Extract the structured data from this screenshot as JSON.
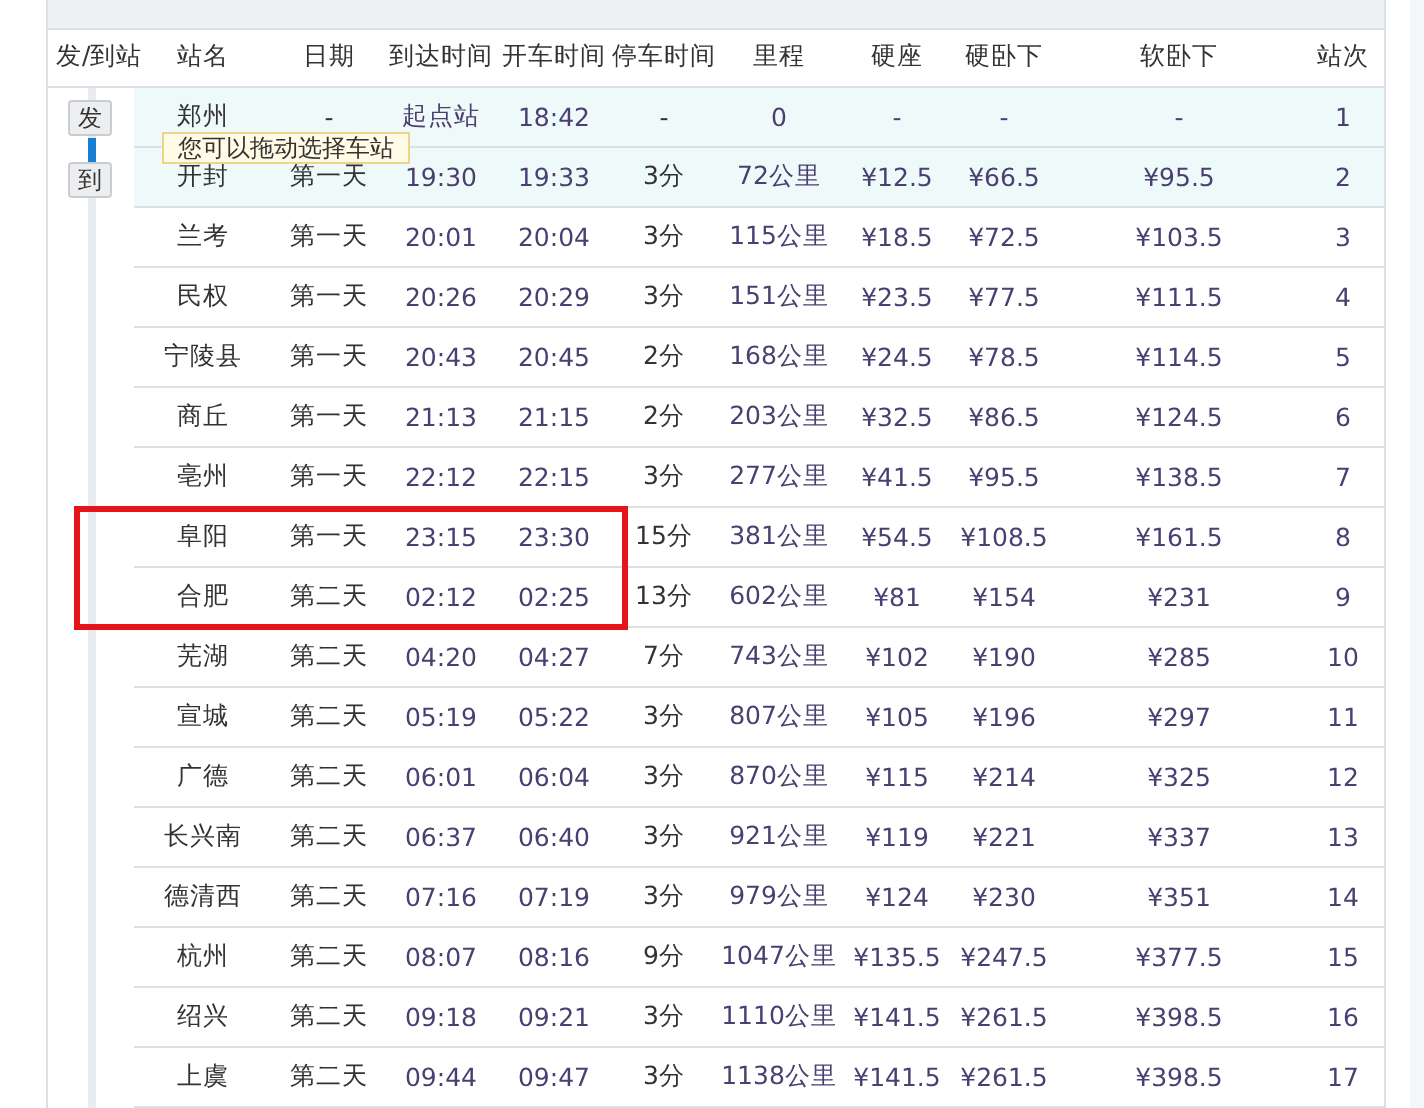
{
  "columns": [
    "发/到站",
    "站名",
    "日期",
    "到达时间",
    "开车时间",
    "停车时间",
    "里程",
    "硬座",
    "硬卧下",
    "软卧下",
    "站次"
  ],
  "slider": {
    "from_label": "发",
    "to_label": "到",
    "tooltip": "您可以拖动选择车站"
  },
  "rows": [
    {
      "cells": [
        "郑州",
        "-",
        "起点站",
        "18:42",
        "-",
        "0",
        "-",
        "-",
        "-",
        "1"
      ],
      "selected": true,
      "outlined": false
    },
    {
      "cells": [
        "开封",
        "第一天",
        "19:30",
        "19:33",
        "3分",
        "72公里",
        "¥12.5",
        "¥66.5",
        "¥95.5",
        "2"
      ],
      "selected": true,
      "outlined": false
    },
    {
      "cells": [
        "兰考",
        "第一天",
        "20:01",
        "20:04",
        "3分",
        "115公里",
        "¥18.5",
        "¥72.5",
        "¥103.5",
        "3"
      ],
      "selected": false,
      "outlined": false
    },
    {
      "cells": [
        "民权",
        "第一天",
        "20:26",
        "20:29",
        "3分",
        "151公里",
        "¥23.5",
        "¥77.5",
        "¥111.5",
        "4"
      ],
      "selected": false,
      "outlined": false
    },
    {
      "cells": [
        "宁陵县",
        "第一天",
        "20:43",
        "20:45",
        "2分",
        "168公里",
        "¥24.5",
        "¥78.5",
        "¥114.5",
        "5"
      ],
      "selected": false,
      "outlined": false
    },
    {
      "cells": [
        "商丘",
        "第一天",
        "21:13",
        "21:15",
        "2分",
        "203公里",
        "¥32.5",
        "¥86.5",
        "¥124.5",
        "6"
      ],
      "selected": false,
      "outlined": false
    },
    {
      "cells": [
        "亳州",
        "第一天",
        "22:12",
        "22:15",
        "3分",
        "277公里",
        "¥41.5",
        "¥95.5",
        "¥138.5",
        "7"
      ],
      "selected": false,
      "outlined": false
    },
    {
      "cells": [
        "阜阳",
        "第一天",
        "23:15",
        "23:30",
        "15分",
        "381公里",
        "¥54.5",
        "¥108.5",
        "¥161.5",
        "8"
      ],
      "selected": false,
      "outlined": true
    },
    {
      "cells": [
        "合肥",
        "第二天",
        "02:12",
        "02:25",
        "13分",
        "602公里",
        "¥81",
        "¥154",
        "¥231",
        "9"
      ],
      "selected": false,
      "outlined": true
    },
    {
      "cells": [
        "芜湖",
        "第二天",
        "04:20",
        "04:27",
        "7分",
        "743公里",
        "¥102",
        "¥190",
        "¥285",
        "10"
      ],
      "selected": false,
      "outlined": false
    },
    {
      "cells": [
        "宣城",
        "第二天",
        "05:19",
        "05:22",
        "3分",
        "807公里",
        "¥105",
        "¥196",
        "¥297",
        "11"
      ],
      "selected": false,
      "outlined": false
    },
    {
      "cells": [
        "广德",
        "第二天",
        "06:01",
        "06:04",
        "3分",
        "870公里",
        "¥115",
        "¥214",
        "¥325",
        "12"
      ],
      "selected": false,
      "outlined": false
    },
    {
      "cells": [
        "长兴南",
        "第二天",
        "06:37",
        "06:40",
        "3分",
        "921公里",
        "¥119",
        "¥221",
        "¥337",
        "13"
      ],
      "selected": false,
      "outlined": false
    },
    {
      "cells": [
        "德清西",
        "第二天",
        "07:16",
        "07:19",
        "3分",
        "979公里",
        "¥124",
        "¥230",
        "¥351",
        "14"
      ],
      "selected": false,
      "outlined": false
    },
    {
      "cells": [
        "杭州",
        "第二天",
        "08:07",
        "08:16",
        "9分",
        "1047公里",
        "¥135.5",
        "¥247.5",
        "¥377.5",
        "15"
      ],
      "selected": false,
      "outlined": false
    },
    {
      "cells": [
        "绍兴",
        "第二天",
        "09:18",
        "09:21",
        "3分",
        "1110公里",
        "¥141.5",
        "¥261.5",
        "¥398.5",
        "16"
      ],
      "selected": false,
      "outlined": false
    },
    {
      "cells": [
        "上虞",
        "第二天",
        "09:44",
        "09:47",
        "3分",
        "1138公里",
        "¥141.5",
        "¥261.5",
        "¥398.5",
        "17"
      ],
      "selected": false,
      "outlined": false
    }
  ]
}
